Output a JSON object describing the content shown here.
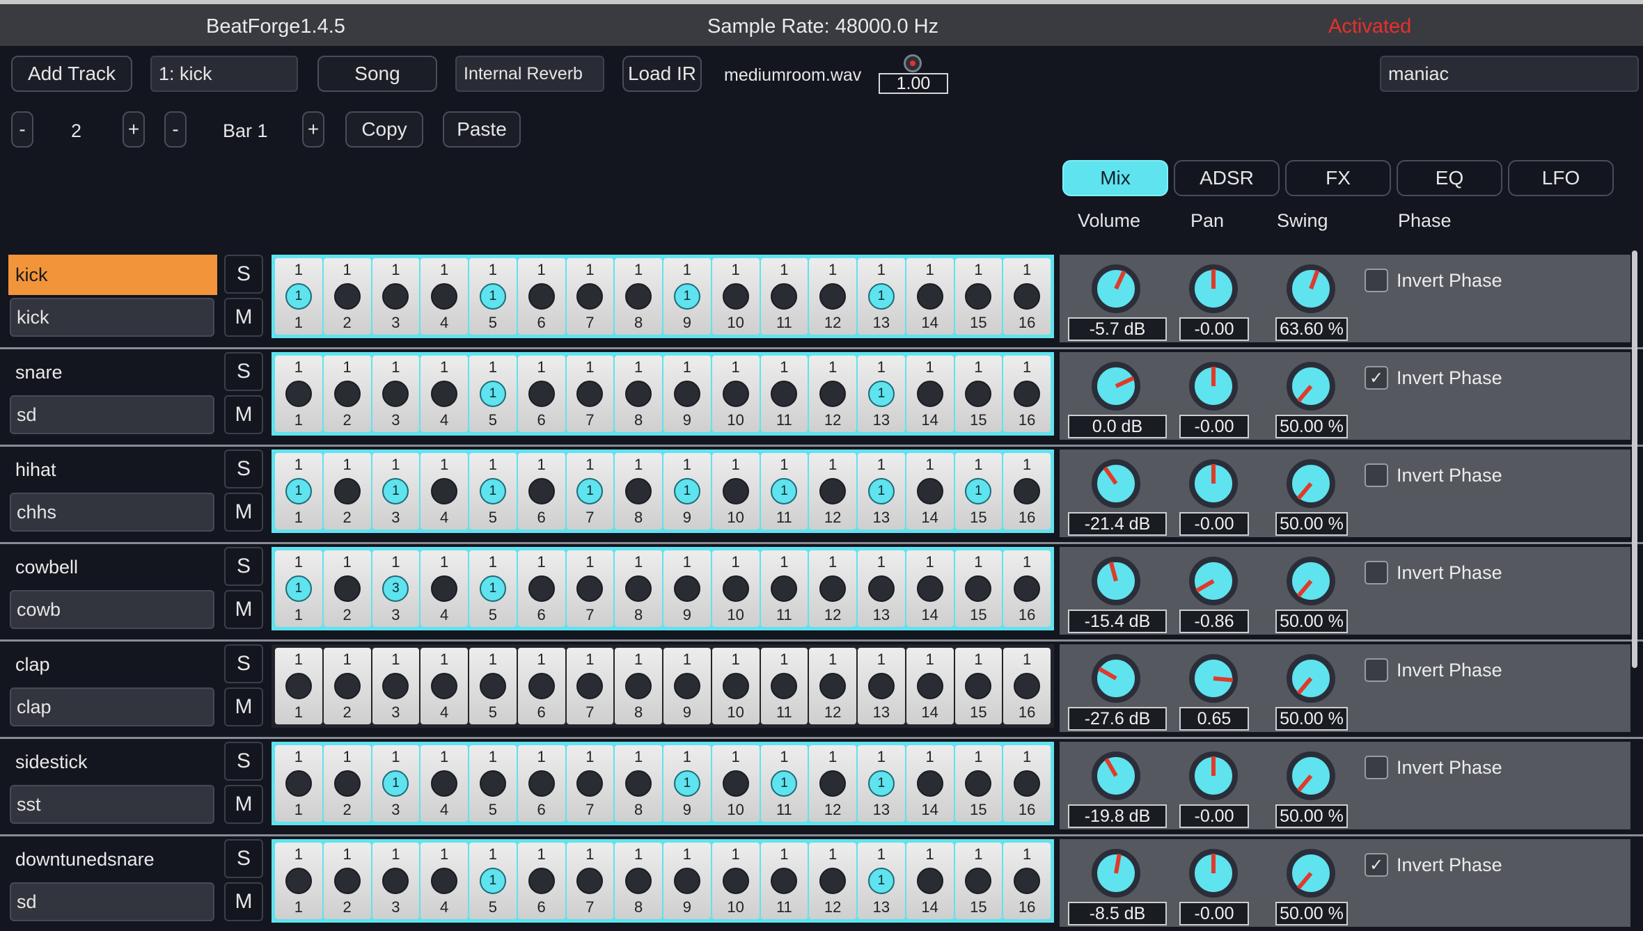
{
  "title": {
    "app": "BeatForge1.4.5",
    "sample_rate": "Sample Rate: 48000.0 Hz",
    "status": "Activated"
  },
  "toolbar": {
    "add_track": "Add Track",
    "track_select": "1: kick",
    "song": "Song",
    "reverb": "Internal Reverb",
    "load_ir": "Load IR",
    "ir_file": "mediumroom.wav",
    "ir_mix": "1.00",
    "preset": "maniac"
  },
  "bars": {
    "minus1": "-",
    "count": "2",
    "plus1": "+",
    "minus2": "-",
    "bar_label": "Bar 1",
    "plus2": "+",
    "copy": "Copy",
    "paste": "Paste"
  },
  "tabs": [
    {
      "label": "Mix",
      "active": true
    },
    {
      "label": "ADSR",
      "active": false
    },
    {
      "label": "FX",
      "active": false
    },
    {
      "label": "EQ",
      "active": false
    },
    {
      "label": "LFO",
      "active": false
    }
  ],
  "columns": {
    "volume": "Volume",
    "pan": "Pan",
    "swing": "Swing",
    "phase": "Phase"
  },
  "solo_label": "S",
  "mute_label": "M",
  "invert_label": "Invert Phase",
  "tracks": [
    {
      "name": "kick",
      "sample": "kick",
      "selected": true,
      "steps": [
        1,
        0,
        0,
        0,
        1,
        0,
        0,
        0,
        1,
        0,
        0,
        0,
        1,
        0,
        0,
        0
      ],
      "volume": "-5.7 dB",
      "pan": "-0.00",
      "swing": "63.60 %",
      "invert": false,
      "vol_angle": 25,
      "pan_angle": 0,
      "sw_angle": 20
    },
    {
      "name": "snare",
      "sample": "sd",
      "selected": false,
      "steps": [
        0,
        0,
        0,
        0,
        1,
        0,
        0,
        0,
        0,
        0,
        0,
        0,
        1,
        0,
        0,
        0
      ],
      "volume": "0.0 dB",
      "pan": "-0.00",
      "swing": "50.00 %",
      "invert": true,
      "vol_angle": 65,
      "pan_angle": 0,
      "sw_angle": -140
    },
    {
      "name": "hihat",
      "sample": "chhs",
      "selected": false,
      "steps": [
        1,
        0,
        1,
        0,
        1,
        0,
        1,
        0,
        1,
        0,
        1,
        0,
        1,
        0,
        1,
        0
      ],
      "volume": "-21.4 dB",
      "pan": "-0.00",
      "swing": "50.00 %",
      "invert": false,
      "vol_angle": -35,
      "pan_angle": 0,
      "sw_angle": -140
    },
    {
      "name": "cowbell",
      "sample": "cowb",
      "selected": false,
      "steps": [
        1,
        0,
        3,
        0,
        1,
        0,
        0,
        0,
        0,
        0,
        0,
        0,
        0,
        0,
        0,
        0
      ],
      "volume": "-15.4 dB",
      "pan": "-0.86",
      "swing": "50.00 %",
      "invert": false,
      "vol_angle": -15,
      "pan_angle": -120,
      "sw_angle": -140
    },
    {
      "name": "clap",
      "sample": "clap",
      "selected": false,
      "steps": [
        0,
        0,
        0,
        0,
        0,
        0,
        0,
        0,
        0,
        0,
        0,
        0,
        0,
        0,
        0,
        0
      ],
      "volume": "-27.6 dB",
      "pan": "0.65",
      "swing": "50.00 %",
      "invert": false,
      "vol_angle": -60,
      "pan_angle": 95,
      "sw_angle": -140
    },
    {
      "name": "sidestick",
      "sample": "sst",
      "selected": false,
      "steps": [
        0,
        0,
        1,
        0,
        0,
        0,
        0,
        0,
        1,
        0,
        1,
        0,
        1,
        0,
        0,
        0
      ],
      "volume": "-19.8 dB",
      "pan": "-0.00",
      "swing": "50.00 %",
      "invert": false,
      "vol_angle": -30,
      "pan_angle": 0,
      "sw_angle": -140
    },
    {
      "name": "downtunedsnare",
      "sample": "sd",
      "selected": false,
      "steps": [
        0,
        0,
        0,
        0,
        1,
        0,
        0,
        0,
        0,
        0,
        0,
        0,
        1,
        0,
        0,
        0
      ],
      "volume": "-8.5 dB",
      "pan": "-0.00",
      "swing": "50.00 %",
      "invert": true,
      "vol_angle": 10,
      "pan_angle": 0,
      "sw_angle": -140
    }
  ],
  "colors": {
    "accent": "#5fe3ee",
    "selected_track": "#f2953a",
    "status": "#e8302a",
    "knob_needle": "#e03a2a"
  }
}
